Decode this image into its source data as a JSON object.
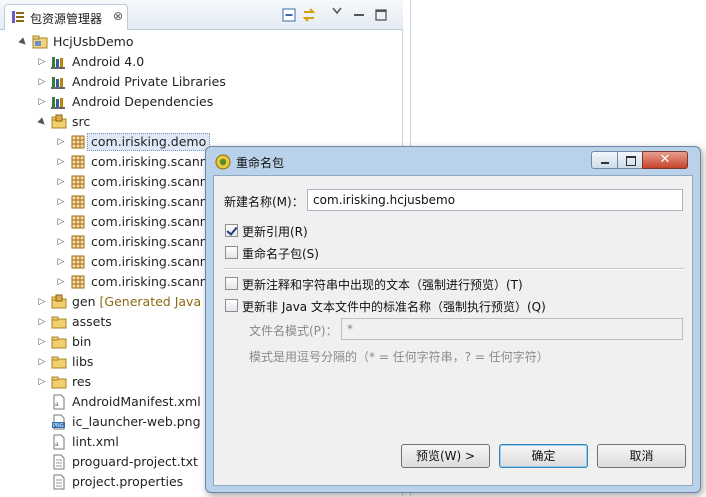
{
  "explorer": {
    "tab_title": "包资源管理器",
    "tab_close": "⊗",
    "icons": [
      "package-explorer-icon",
      "collapse-all-icon",
      "link-with-editor-icon",
      "view-menu-icon",
      "minimize-icon",
      "maximize-icon"
    ]
  },
  "tree": [
    {
      "label": "HcjUsbDemo",
      "decor": "",
      "icon": "java-project-icon",
      "arrow": "▲",
      "level": 0
    },
    {
      "label": "Android 4.0",
      "decor": "",
      "icon": "library-icon",
      "arrow": "▷",
      "level": 1
    },
    {
      "label": "Android Private Libraries",
      "decor": "",
      "icon": "library-icon",
      "arrow": "▷",
      "level": 1
    },
    {
      "label": "Android Dependencies",
      "decor": "",
      "icon": "library-icon",
      "arrow": "▷",
      "level": 1
    },
    {
      "label": "src",
      "decor": "",
      "icon": "source-folder-icon",
      "arrow": "▲",
      "level": 1
    },
    {
      "label": "com.irisking.demo",
      "decor": "",
      "icon": "package-icon",
      "arrow": "▷",
      "level": 2,
      "selected": true
    },
    {
      "label": "com.irisking.scanne",
      "decor": "",
      "icon": "package-icon",
      "arrow": "▷",
      "level": 2
    },
    {
      "label": "com.irisking.scanne",
      "decor": "",
      "icon": "package-icon",
      "arrow": "▷",
      "level": 2
    },
    {
      "label": "com.irisking.scanne",
      "decor": "",
      "icon": "package-icon",
      "arrow": "▷",
      "level": 2
    },
    {
      "label": "com.irisking.scanne",
      "decor": "",
      "icon": "package-icon",
      "arrow": "▷",
      "level": 2
    },
    {
      "label": "com.irisking.scanne",
      "decor": "",
      "icon": "package-icon",
      "arrow": "▷",
      "level": 2
    },
    {
      "label": "com.irisking.scanne",
      "decor": "",
      "icon": "package-icon",
      "arrow": "▷",
      "level": 2
    },
    {
      "label": "com.irisking.scanne",
      "decor": "",
      "icon": "package-icon",
      "arrow": "▷",
      "level": 2
    },
    {
      "label": "gen",
      "decor": " [Generated Java F",
      "icon": "source-folder-icon",
      "arrow": "▷",
      "level": 1
    },
    {
      "label": "assets",
      "decor": "",
      "icon": "folder-icon",
      "arrow": "▷",
      "level": 1
    },
    {
      "label": "bin",
      "decor": "",
      "icon": "folder-icon",
      "arrow": "▷",
      "level": 1
    },
    {
      "label": "libs",
      "decor": "",
      "icon": "folder-icon",
      "arrow": "▷",
      "level": 1
    },
    {
      "label": "res",
      "decor": "",
      "icon": "folder-icon",
      "arrow": "▷",
      "level": 1
    },
    {
      "label": "AndroidManifest.xml",
      "decor": "",
      "icon": "xml-file-icon",
      "arrow": "",
      "level": 1
    },
    {
      "label": "ic_launcher-web.png",
      "decor": "",
      "icon": "png-file-icon",
      "arrow": "",
      "level": 1
    },
    {
      "label": "lint.xml",
      "decor": "",
      "icon": "xml-file-icon",
      "arrow": "",
      "level": 1
    },
    {
      "label": "proguard-project.txt",
      "decor": "",
      "icon": "text-file-icon",
      "arrow": "",
      "level": 1
    },
    {
      "label": "project.properties",
      "decor": "",
      "icon": "text-file-icon",
      "arrow": "",
      "level": 1
    }
  ],
  "dialog": {
    "title": "重命名包",
    "title_icon": "rename-dialog-icon",
    "close_glyph": "✕",
    "new_name_label": "新建名称(M)：",
    "new_name_value": "com.irisking.hcjusbemo",
    "update_references": {
      "label": "更新引用(R)",
      "checked": true
    },
    "rename_subpackages": {
      "label": "重命名子包(S)",
      "checked": false
    },
    "update_comments": {
      "label": "更新注释和字符串中出现的文本（强制进行预览）(T)",
      "checked": false
    },
    "update_non_java": {
      "label": "更新非 Java 文本文件中的标准名称（强制执行预览）(Q)",
      "checked": false
    },
    "file_pattern_label": "文件名模式(P)：",
    "file_pattern_value": "*",
    "hint": "模式是用逗号分隔的（* = 任何字符串，? = 任何字符）",
    "buttons": {
      "preview": "预览(W) >",
      "ok": "确定",
      "cancel": "取消"
    }
  }
}
